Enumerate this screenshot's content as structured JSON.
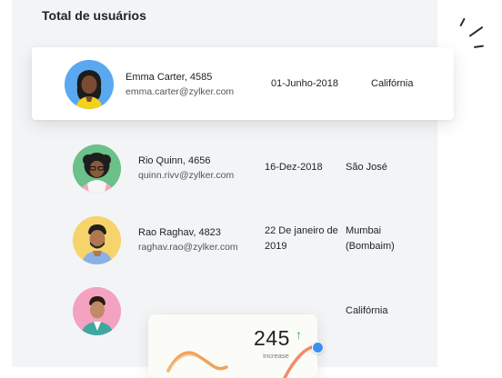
{
  "panel": {
    "title": "Total de usuários"
  },
  "users": [
    {
      "name": "Emma Carter, 4585",
      "email": "emma.carter@zylker.com",
      "date": "01-Junho-2018",
      "city": "Califórnia",
      "avatar_bg": "#5aa8f0",
      "highlighted": true
    },
    {
      "name": "Rio Quinn, 4656",
      "email": "quinn.rivv@zylker.com",
      "date": "16-Dez-2018",
      "city": "São José",
      "avatar_bg": "#6cc08a"
    },
    {
      "name": "Rao Raghav, 4823",
      "email": "raghav.rao@zylker.com",
      "date_line1": "22 De janeiro de",
      "date_line2": "2019",
      "city_line1": "Mumbai",
      "city_line2": "(Bombaim)",
      "avatar_bg": "#f7d36b"
    },
    {
      "name": "",
      "email": "",
      "date": "",
      "city": "Califórnia",
      "avatar_bg": "#f3a3bf"
    }
  ],
  "widget": {
    "value": "245",
    "label": "Increase",
    "trend_icon": "arrow-up-icon",
    "trend_color": "#2fa84f",
    "dot_color": "#3b8ff0"
  }
}
